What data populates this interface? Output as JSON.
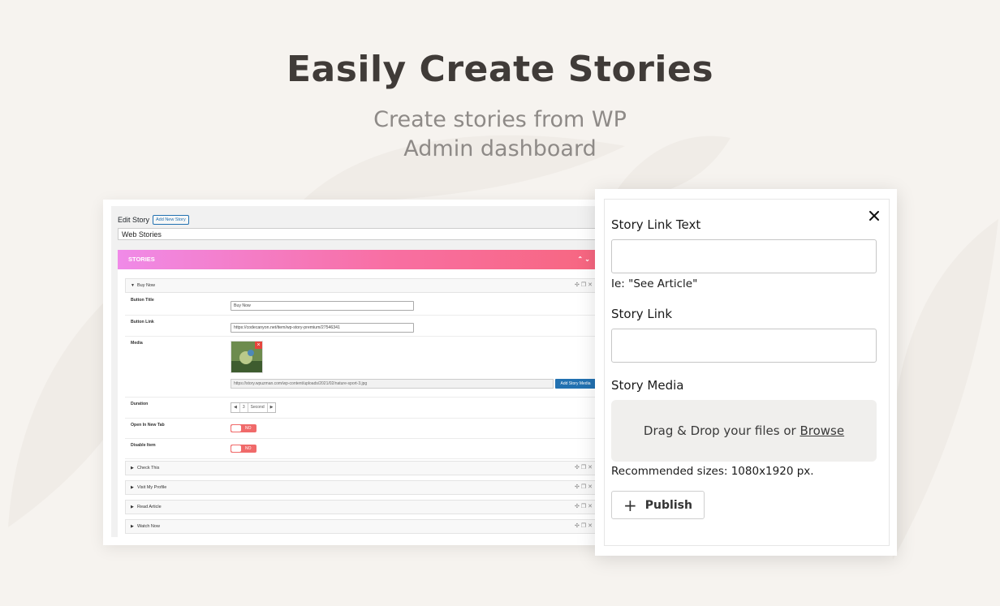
{
  "hero": {
    "title": "Easily Create Stories",
    "subtitle_line1": "Create stories from WP",
    "subtitle_line2": "Admin dashboard"
  },
  "admin": {
    "edit_label": "Edit Story",
    "add_new_label": "Add New Story",
    "title_value": "Web Stories",
    "stories_header": "STORIES",
    "open_item": {
      "title": "Buy Now",
      "fields": {
        "button_title_label": "Button Title",
        "button_title_value": "Buy Now",
        "button_link_label": "Button Link",
        "button_link_value": "https://codecanyon.net/item/wp-story-premium/27546341",
        "media_label": "Media",
        "media_url": "https://story.wpuzman.com/wp-content/uploads/2021/02/nature-sport-3.jpg",
        "add_media_label": "Add Story Media",
        "duration_label": "Duration",
        "duration_value": "3",
        "duration_unit": "Second",
        "open_new_tab_label": "Open In New Tab",
        "open_new_tab_state": "NO",
        "disable_item_label": "Disable Item",
        "disable_item_state": "NO"
      }
    },
    "collapsed_items": [
      "Check This",
      "Visit My Profile",
      "Read Article",
      "Watch Now"
    ]
  },
  "form": {
    "link_text_label": "Story Link Text",
    "link_text_value": "",
    "link_text_hint": "Ie: \"See Article\"",
    "link_label": "Story Link",
    "link_value": "",
    "media_label": "Story Media",
    "drop_text": "Drag & Drop your files or ",
    "browse_text": "Browse",
    "recommended": "Recommended sizes: 1080x1920 px.",
    "publish_label": "Publish"
  },
  "colors": {
    "background": "#f6f3ef",
    "gradient_start": "#f08ae8",
    "gradient_end": "#f7667f",
    "wp_blue": "#2271b1",
    "toggle_red": "#f06a6a"
  }
}
